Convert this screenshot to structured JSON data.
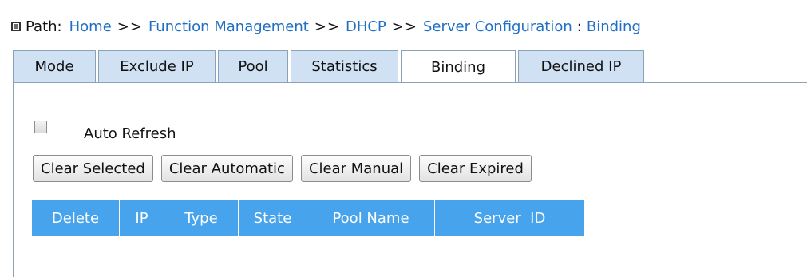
{
  "path": {
    "label": "Path:",
    "crumbs": [
      "Home",
      "Function Management",
      "DHCP",
      "Server Configuration"
    ],
    "separator": ">>",
    "current": "Binding"
  },
  "tabs": [
    {
      "label": "Mode"
    },
    {
      "label": "Exclude IP"
    },
    {
      "label": "Pool"
    },
    {
      "label": "Statistics"
    },
    {
      "label": "Binding",
      "active": true
    },
    {
      "label": "Declined IP"
    }
  ],
  "auto_refresh": {
    "label": "Auto Refresh",
    "checked": false
  },
  "buttons": {
    "clear_selected": "Clear Selected",
    "clear_automatic": "Clear Automatic",
    "clear_manual": "Clear Manual",
    "clear_expired": "Clear Expired"
  },
  "table": {
    "columns": [
      "Delete",
      "IP",
      "Type",
      "State",
      "Pool Name",
      "Server  ID"
    ],
    "rows": []
  },
  "colors": {
    "link": "#1f6fc5",
    "tab_bg": "#cfe1f2",
    "table_header_bg": "#46a3ec"
  }
}
